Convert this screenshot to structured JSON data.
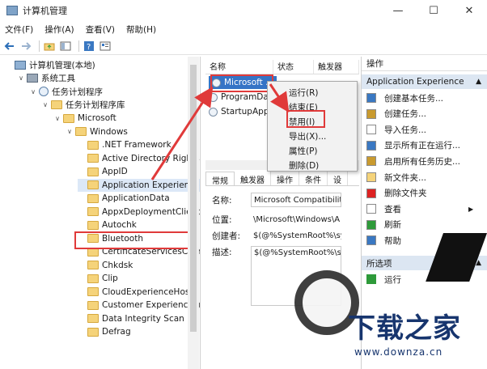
{
  "window": {
    "title": "计算机管理",
    "controls": {
      "minimize": "—",
      "maximize": "☐",
      "close": "✕"
    }
  },
  "menu": [
    "文件(F)",
    "操作(A)",
    "查看(V)",
    "帮助(H)"
  ],
  "toolbar": [
    "back-icon",
    "forward-icon",
    "up-folder-icon",
    "show-tree-icon",
    "help-icon",
    "properties-icon"
  ],
  "tree": {
    "items": [
      {
        "label": "计算机管理(本地)",
        "indent": 0,
        "expander": "",
        "icon": "pc"
      },
      {
        "label": "系统工具",
        "indent": 1,
        "expander": "∨",
        "icon": "tools"
      },
      {
        "label": "任务计划程序",
        "indent": 2,
        "expander": "∨",
        "icon": "clock"
      },
      {
        "label": "任务计划程序库",
        "indent": 3,
        "expander": "∨",
        "icon": "folder"
      },
      {
        "label": "Microsoft",
        "indent": 4,
        "expander": "∨",
        "icon": "folder"
      },
      {
        "label": "Windows",
        "indent": 5,
        "expander": "∨",
        "icon": "folder"
      },
      {
        "label": ".NET Framework",
        "indent": 6,
        "expander": "",
        "icon": "folder"
      },
      {
        "label": "Active Directory Rights M",
        "indent": 6,
        "expander": "",
        "icon": "folder"
      },
      {
        "label": "AppID",
        "indent": 6,
        "expander": "",
        "icon": "folder"
      },
      {
        "label": "Application Experience",
        "indent": 6,
        "expander": "",
        "icon": "folder",
        "selected": true
      },
      {
        "label": "ApplicationData",
        "indent": 6,
        "expander": "",
        "icon": "folder"
      },
      {
        "label": "AppxDeploymentClient",
        "indent": 6,
        "expander": "",
        "icon": "folder"
      },
      {
        "label": "Autochk",
        "indent": 6,
        "expander": "",
        "icon": "folder"
      },
      {
        "label": "Bluetooth",
        "indent": 6,
        "expander": "",
        "icon": "folder"
      },
      {
        "label": "CertificateServicesClient",
        "indent": 6,
        "expander": "",
        "icon": "folder"
      },
      {
        "label": "Chkdsk",
        "indent": 6,
        "expander": "",
        "icon": "folder"
      },
      {
        "label": "Clip",
        "indent": 6,
        "expander": "",
        "icon": "folder"
      },
      {
        "label": "CloudExperienceHost",
        "indent": 6,
        "expander": "",
        "icon": "folder"
      },
      {
        "label": "Customer Experience Im",
        "indent": 6,
        "expander": "",
        "icon": "folder"
      },
      {
        "label": "Data Integrity Scan",
        "indent": 6,
        "expander": "",
        "icon": "folder"
      },
      {
        "label": "Defrag",
        "indent": 6,
        "expander": "",
        "icon": "folder"
      }
    ]
  },
  "task_list": {
    "columns": [
      "名称",
      "状态",
      "触发器"
    ],
    "rows": [
      "Microsoft ...",
      "ProgramDa...",
      "StartupApp..."
    ]
  },
  "context_menu": {
    "items": [
      "运行(R)",
      "结束(E)",
      "禁用(I)",
      "导出(X)...",
      "属性(P)",
      "删除(D)"
    ]
  },
  "details": {
    "tabs": [
      "常规",
      "触发器",
      "操作",
      "条件",
      "设"
    ],
    "name_label": "名称:",
    "name_value": "Microsoft Compatibilit",
    "location_label": "位置:",
    "location_value": "\\Microsoft\\Windows\\A",
    "author_label": "创建者:",
    "author_value": "$(@%SystemRoot%\\sy",
    "desc_label": "描述:",
    "desc_value": "$(@%SystemRoot%\\sy"
  },
  "actions": {
    "header": "操作",
    "section1": "Application Experience",
    "items1": [
      {
        "label": "创建基本任务...",
        "icon": "create-basic-task-icon",
        "color": "#3a78c2"
      },
      {
        "label": "创建任务...",
        "icon": "create-task-icon",
        "color": "#c99a2e"
      },
      {
        "label": "导入任务...",
        "icon": "import-task-icon",
        "color": "#ffffff"
      },
      {
        "label": "显示所有正在运行...",
        "icon": "running-tasks-icon",
        "color": "#3a78c2"
      },
      {
        "label": "启用所有任务历史...",
        "icon": "task-history-icon",
        "color": "#c99a2e"
      },
      {
        "label": "新文件夹...",
        "icon": "new-folder-icon",
        "color": "#f5d37a"
      },
      {
        "label": "删除文件夹",
        "icon": "delete-folder-icon",
        "color": "#d22"
      },
      {
        "label": "查看",
        "icon": "view-icon",
        "color": "#ffffff"
      },
      {
        "label": "刷新",
        "icon": "refresh-icon",
        "color": "#2e9a3a"
      },
      {
        "label": "帮助",
        "icon": "help-icon",
        "color": "#3a78c2"
      }
    ],
    "section2": "所选项",
    "items2": [
      {
        "label": "运行",
        "icon": "run-icon",
        "color": "#2e9a3a"
      }
    ]
  },
  "watermark": {
    "logo": "下载之家",
    "url": "www.downza.cn"
  },
  "colors": {
    "highlight": "#e03a3a",
    "selection": "#3574c6",
    "section": "#dce6f2"
  }
}
